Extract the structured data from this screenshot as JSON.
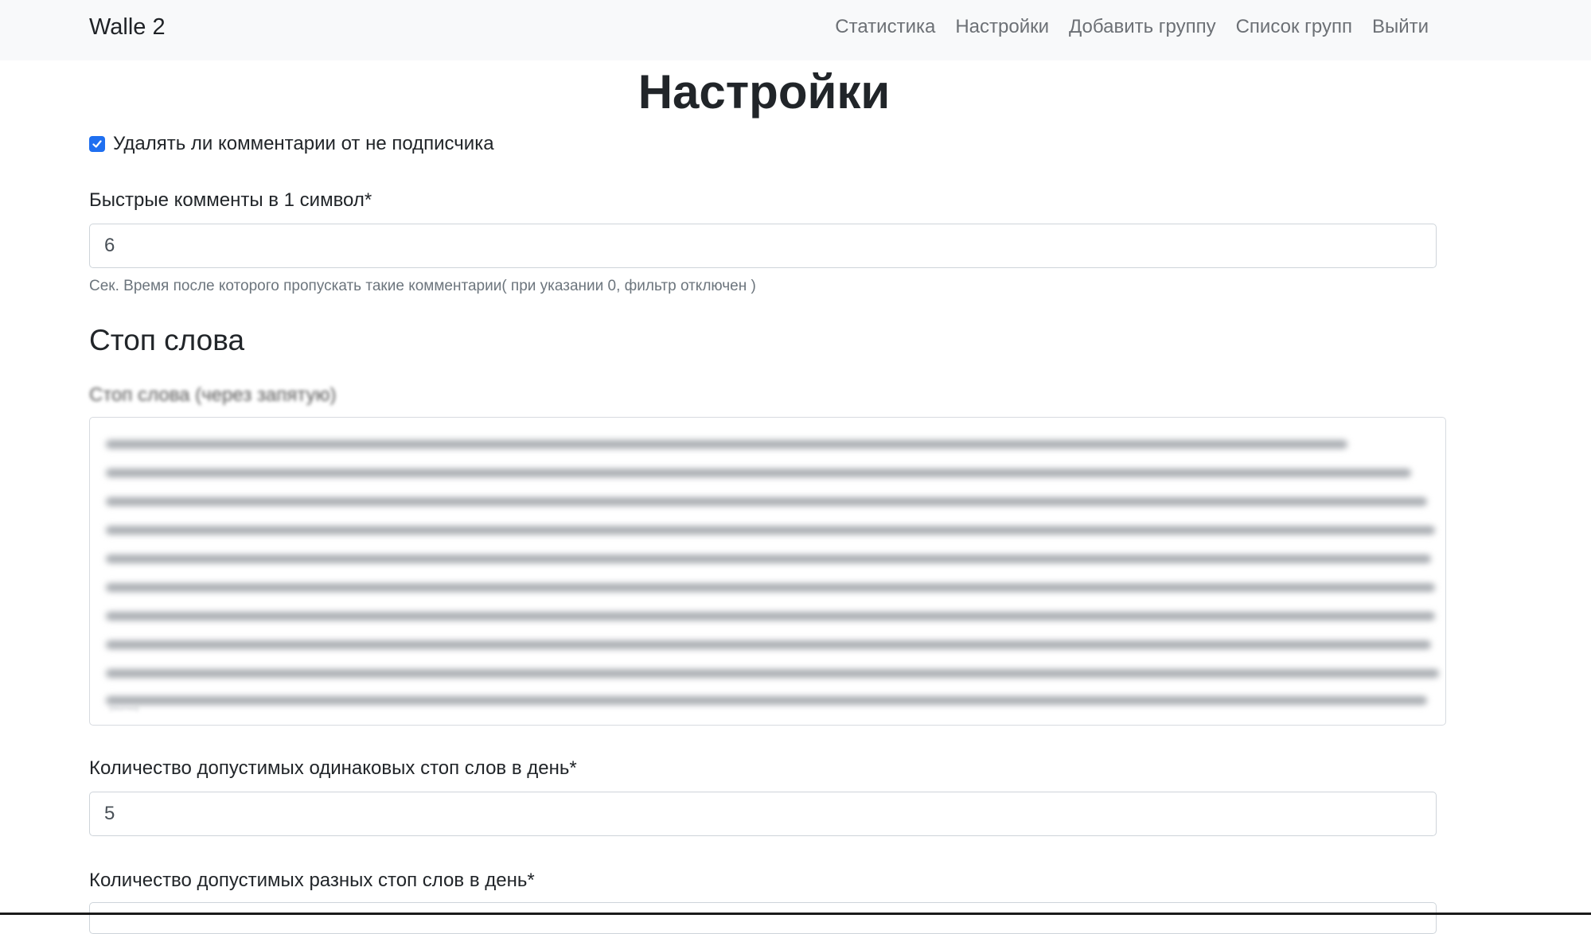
{
  "navbar": {
    "brand": "Walle 2",
    "links": [
      "Статистика",
      "Настройки",
      "Добавить группу",
      "Список групп",
      "Выйти"
    ]
  },
  "page": {
    "title": "Настройки"
  },
  "settings": {
    "delete_nonsub": {
      "label": "Удалять ли комментарии от не подписчика",
      "checked": true
    },
    "quick_comments": {
      "label": "Быстрые комменты в 1 символ*",
      "value": "6",
      "help": "Сек. Время после которого пропускать такие комментарии( при указании 0, фильтр отключен )"
    }
  },
  "stopwords": {
    "section_title": "Стоп слова",
    "field_label": "Стоп слова (через запятую)",
    "textarea_content": "(blurred)"
  },
  "limits": {
    "same_label": "Количество допустимых одинаковых стоп слов в день*",
    "same_value": "5",
    "diff_label": "Количество допустимых разных стоп слов в день*"
  },
  "colors": {
    "accent": "#1f6ff0",
    "navbar_bg": "#f8f9fa",
    "nav_link": "#6c7075",
    "help_text": "#6c757d"
  }
}
